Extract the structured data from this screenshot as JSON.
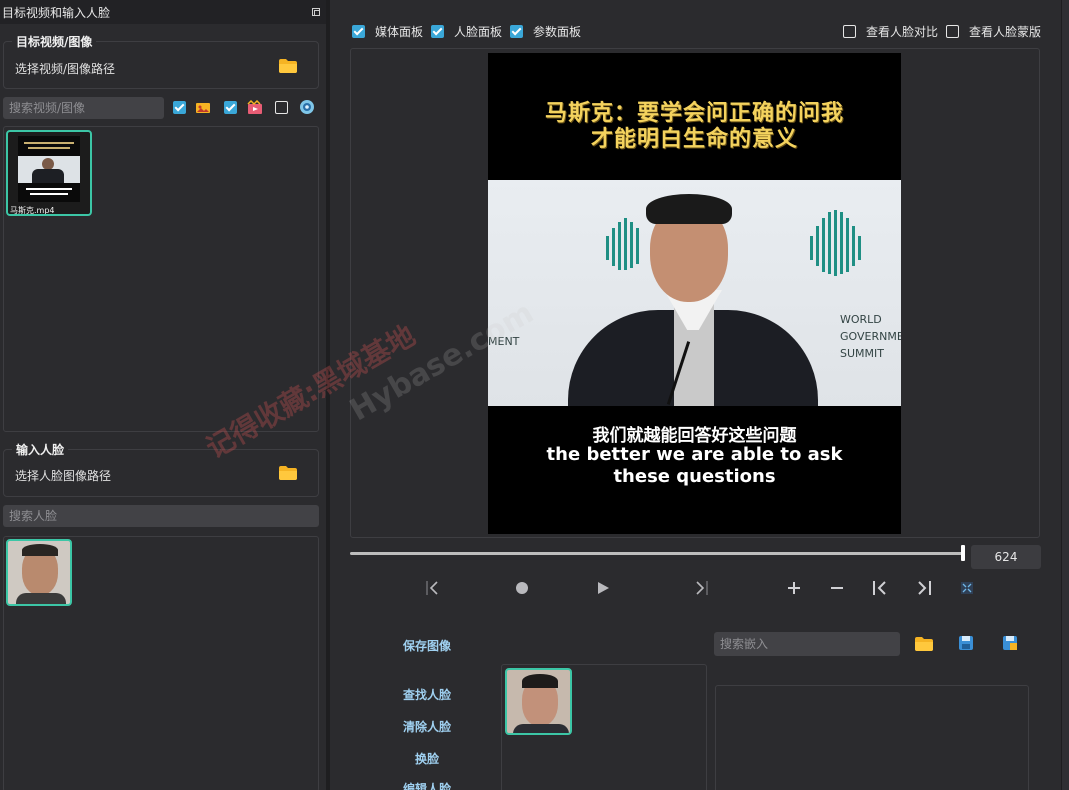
{
  "left_panel": {
    "title": "目标视频和输入人脸",
    "target_group": {
      "title": "目标视频/图像",
      "path_label": "选择视频/图像路径"
    },
    "search_videos_placeholder": "搜索视频/图像",
    "filters": [
      {
        "checked": true,
        "icon": "image-icon"
      },
      {
        "checked": true,
        "icon": "video-icon"
      },
      {
        "checked": false,
        "icon": "webcam-icon"
      }
    ],
    "media_items": [
      {
        "label": "马斯克.mp4"
      }
    ],
    "input_face_group": {
      "title": "输入人脸",
      "path_label": "选择人脸图像路径"
    },
    "search_faces_placeholder": "搜索人脸"
  },
  "top_options": {
    "media_panel": {
      "label": "媒体面板",
      "checked": true
    },
    "face_panel": {
      "label": "人脸面板",
      "checked": true
    },
    "params_panel": {
      "label": "参数面板",
      "checked": true
    },
    "face_compare": {
      "label": "查看人脸对比",
      "checked": false
    },
    "face_mask": {
      "label": "查看人脸蒙版",
      "checked": false
    }
  },
  "video": {
    "caption_top_line1": "马斯克：要学会问正确的问我",
    "caption_top_line2": "才能明白生命的意义",
    "scene_text_left": "MENT",
    "scene_text_right_1": "WORLD",
    "scene_text_right_2": "GOVERNMEN",
    "scene_text_right_3": "SUMMIT",
    "caption_bottom_zh": "我们就越能回答好这些问题",
    "caption_bottom_en_1": "the better we are able to ask",
    "caption_bottom_en_2": "these questions"
  },
  "playback": {
    "frame_number": "624",
    "progress": 0.995
  },
  "actions": {
    "save_image": "保存图像",
    "find_faces": "查找人脸",
    "clear_faces": "清除人脸",
    "swap_faces": "换脸",
    "edit_faces": "编辑人脸"
  },
  "embedding": {
    "search_placeholder": "搜索嵌入"
  },
  "watermark": {
    "text_cn": "记得收藏:黑域基地",
    "text_en": "Hybase.com"
  },
  "colors": {
    "accent_check": "#3aa7d8",
    "thumb_border": "#3cc6a6",
    "caption_gold": "#f4d35e",
    "folder": "#f5b323"
  }
}
